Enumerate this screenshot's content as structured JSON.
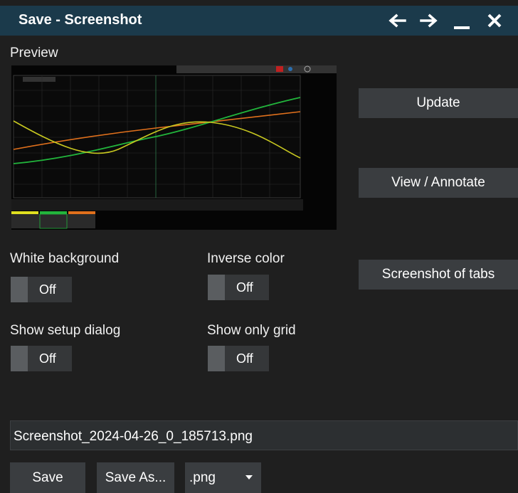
{
  "title": "Save - Screenshot",
  "titlebar_icons": [
    "arrow-left-icon",
    "arrow-right-icon",
    "minimize-icon",
    "close-icon"
  ],
  "preview_label": "Preview",
  "buttons": {
    "update": "Update",
    "view_annotate": "View / Annotate",
    "screenshot_tabs": "Screenshot of tabs",
    "save": "Save",
    "save_as": "Save As..."
  },
  "toggles": {
    "white_background": {
      "label": "White background",
      "state": "Off"
    },
    "inverse_color": {
      "label": "Inverse color",
      "state": "Off"
    },
    "show_setup_dialog": {
      "label": "Show setup dialog",
      "state": "Off"
    },
    "show_only_grid": {
      "label": "Show only grid",
      "state": "Off"
    }
  },
  "filename": "Screenshot_2024-04-26_0_185713.png",
  "format": ".png",
  "colors": {
    "titlebar": "#1b3a4b",
    "background": "#1f1f1f",
    "button": "#3a3d40",
    "trace_yellow": "#c8c820",
    "trace_green": "#22b53c",
    "trace_orange": "#e0701c"
  }
}
